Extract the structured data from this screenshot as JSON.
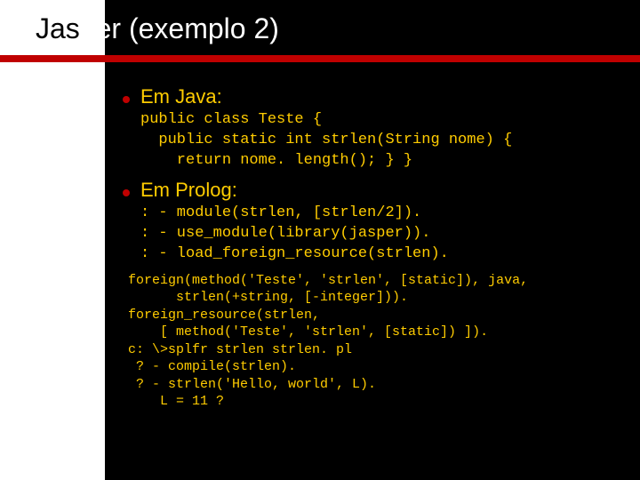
{
  "title_white": "Jas",
  "title_black_rest": "per (exemplo 2)",
  "bullets": {
    "b1": "Em Java:",
    "b2": "Em Prolog:"
  },
  "java_code": "public class Teste {\n  public static int strlen(String nome) {\n    return nome. length(); } }",
  "prolog_code": ": - module(strlen, [strlen/2]).\n: - use_module(library(jasper)).\n: - load_foreign_resource(strlen).",
  "prolog_code2": "foreign(method('Teste', 'strlen', [static]), java,\n      strlen(+string, [-integer])).\nforeign_resource(strlen,\n    [ method('Teste', 'strlen', [static]) ]).\nc: \\>splfr strlen strlen. pl\n ? - compile(strlen).\n ? - strlen('Hello, world', L).\n    L = 11 ?"
}
